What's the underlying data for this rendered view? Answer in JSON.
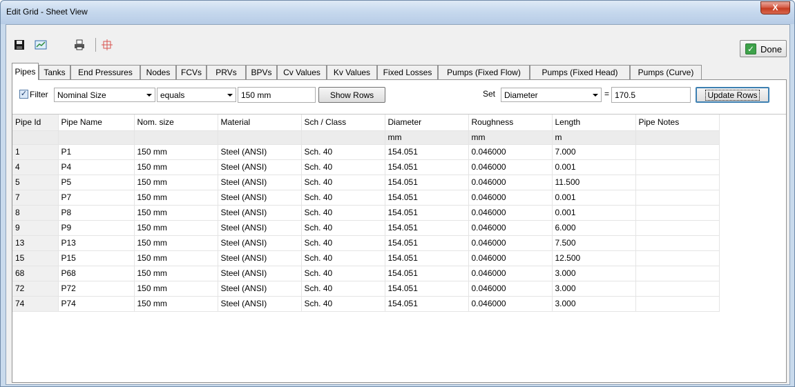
{
  "window": {
    "title": "Edit Grid - Sheet View",
    "close_label": "X"
  },
  "toolbar": {
    "icons": [
      "save-icon",
      "chart-icon",
      "print-icon",
      "target-icon"
    ],
    "done_label": "Done",
    "done_check": "✓"
  },
  "tabs": [
    {
      "label": "Pipes",
      "active": true
    },
    {
      "label": "Tanks"
    },
    {
      "label": "End Pressures"
    },
    {
      "label": "Nodes"
    },
    {
      "label": "FCVs"
    },
    {
      "label": "PRVs"
    },
    {
      "label": "BPVs"
    },
    {
      "label": "Cv Values"
    },
    {
      "label": "Kv Values"
    },
    {
      "label": "Fixed Losses"
    },
    {
      "label": "Pumps (Fixed Flow)"
    },
    {
      "label": "Pumps (Fixed Head)"
    },
    {
      "label": "Pumps (Curve)"
    }
  ],
  "filter": {
    "checked": true,
    "check_glyph": "✓",
    "label": "Filter",
    "field": "Nominal Size",
    "operator": "equals",
    "value": "150 mm",
    "show_rows_label": "Show Rows",
    "set_label": "Set",
    "set_field": "Diameter",
    "equals_sign": "=",
    "set_value": "170.5",
    "update_rows_label": "Update Rows"
  },
  "grid": {
    "headers": [
      "Pipe Id",
      "Pipe Name",
      "Nom. size",
      "Material",
      "Sch / Class",
      "Diameter",
      "Roughness",
      "Length",
      "Pipe Notes"
    ],
    "units": [
      "",
      "",
      "",
      "",
      "",
      "mm",
      "mm",
      "m",
      ""
    ],
    "rows": [
      [
        "1",
        "P1",
        "150 mm",
        "Steel (ANSI)",
        "Sch. 40",
        "154.051",
        "0.046000",
        "7.000",
        ""
      ],
      [
        "4",
        "P4",
        "150 mm",
        "Steel (ANSI)",
        "Sch. 40",
        "154.051",
        "0.046000",
        "0.001",
        ""
      ],
      [
        "5",
        "P5",
        "150 mm",
        "Steel (ANSI)",
        "Sch. 40",
        "154.051",
        "0.046000",
        "11.500",
        ""
      ],
      [
        "7",
        "P7",
        "150 mm",
        "Steel (ANSI)",
        "Sch. 40",
        "154.051",
        "0.046000",
        "0.001",
        ""
      ],
      [
        "8",
        "P8",
        "150 mm",
        "Steel (ANSI)",
        "Sch. 40",
        "154.051",
        "0.046000",
        "0.001",
        ""
      ],
      [
        "9",
        "P9",
        "150 mm",
        "Steel (ANSI)",
        "Sch. 40",
        "154.051",
        "0.046000",
        "6.000",
        ""
      ],
      [
        "13",
        "P13",
        "150 mm",
        "Steel (ANSI)",
        "Sch. 40",
        "154.051",
        "0.046000",
        "7.500",
        ""
      ],
      [
        "15",
        "P15",
        "150 mm",
        "Steel (ANSI)",
        "Sch. 40",
        "154.051",
        "0.046000",
        "12.500",
        ""
      ],
      [
        "68",
        "P68",
        "150 mm",
        "Steel (ANSI)",
        "Sch. 40",
        "154.051",
        "0.046000",
        "3.000",
        ""
      ],
      [
        "72",
        "P72",
        "150 mm",
        "Steel (ANSI)",
        "Sch. 40",
        "154.051",
        "0.046000",
        "3.000",
        ""
      ],
      [
        "74",
        "P74",
        "150 mm",
        "Steel (ANSI)",
        "Sch. 40",
        "154.051",
        "0.046000",
        "3.000",
        ""
      ]
    ]
  }
}
